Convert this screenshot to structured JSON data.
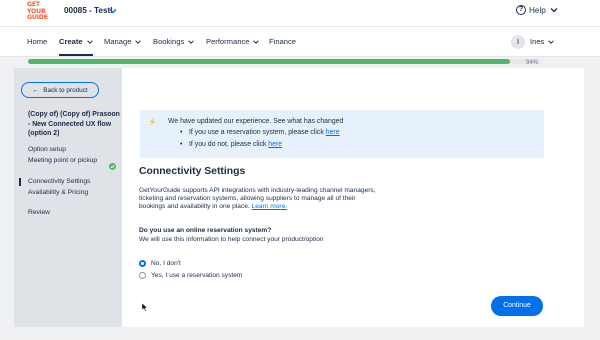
{
  "topbar": {
    "logo_lines": [
      "GET",
      "YOUR",
      "GUIDE"
    ],
    "account": "00085 - Testl",
    "help_label": "Help"
  },
  "nav": {
    "items": [
      {
        "label": "Home"
      },
      {
        "label": "Create"
      },
      {
        "label": "Manage"
      },
      {
        "label": "Bookings"
      },
      {
        "label": "Performance"
      },
      {
        "label": "Finance"
      }
    ],
    "active": "Create",
    "user_initial": "I",
    "user_name": "Ines"
  },
  "progress": {
    "label": "94%",
    "fraction": 0.94
  },
  "sidebar": {
    "back_label": "Back to product",
    "product_title": "(Copy of) (Copy of) Prasoon - New Connected UX flow (option 2)",
    "items": [
      {
        "label": "Option setup"
      },
      {
        "label": "Meeting point or pickup"
      },
      {
        "label": "Connectivity Settings"
      },
      {
        "label": "Availability & Pricing"
      },
      {
        "label": "Review"
      }
    ]
  },
  "notice": {
    "heading": "We have updated our experience. See what has changed",
    "line1_text": "If you use a reservation system, please click ",
    "line2_text": "If you do not, please click ",
    "link_label": "here"
  },
  "content": {
    "title": "Connectivity Settings",
    "description": "GetYourGuide supports API integrations with industry-leading channel managers, ticketing and reservation systems, allowing suppliers to manage all of their bookings and availability in one place.",
    "learn_more": "Learn more.",
    "question": "Do you use an online reservation system?",
    "question_sub": "We will use this information to help connect your product/option",
    "options": [
      {
        "label": "No, I don't",
        "selected": true
      },
      {
        "label": "Yes, I use a reservation system",
        "selected": false
      }
    ],
    "continue_label": "Continue"
  },
  "colors": {
    "brand": "#ff5533",
    "primary": "#0071eb",
    "progress": "#51b769",
    "text": "#1a2b49"
  }
}
